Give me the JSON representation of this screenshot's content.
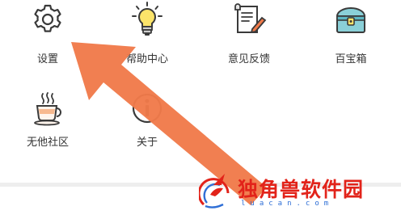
{
  "menu": {
    "items": [
      {
        "label": "设置",
        "icon": "gear-icon"
      },
      {
        "label": "帮助中心",
        "icon": "lightbulb-icon"
      },
      {
        "label": "意见反馈",
        "icon": "feedback-document-icon"
      },
      {
        "label": "百宝箱",
        "icon": "treasure-box-icon"
      },
      {
        "label": "无他社区",
        "icon": "coffee-cup-icon"
      },
      {
        "label": "关于",
        "icon": "info-icon"
      }
    ]
  },
  "annotation": {
    "arrow_color": "#f07a4a",
    "target": "设置"
  },
  "watermark": {
    "brand": "独角兽软件园",
    "url": "luacan.com",
    "brand_color": "#e2231a",
    "url_color": "#2f6fd6"
  }
}
